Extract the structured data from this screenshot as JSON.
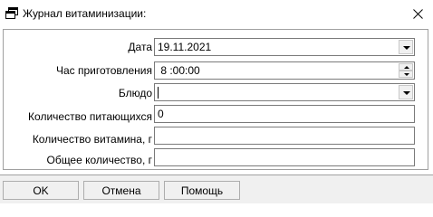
{
  "window": {
    "title": "Журнал витаминизации:",
    "icon": "window-app-icon",
    "close_icon": "close-icon"
  },
  "form": {
    "date": {
      "label": "Дата",
      "value": "19.11.2021",
      "control": "dropdown"
    },
    "prep_time": {
      "label": "Час приготовления",
      "value": " 8 :00:00",
      "control": "spin"
    },
    "dish": {
      "label": "Блюдо",
      "value": "",
      "control": "dropdown"
    },
    "eaters_count": {
      "label": "Количество питающихся",
      "value": "0"
    },
    "vitamin_amount": {
      "label": "Количество витамина, г",
      "value": ""
    },
    "total_amount": {
      "label": "Общее количество, г",
      "value": ""
    }
  },
  "buttons": {
    "ok": "OK",
    "cancel": "Отмена",
    "help": "Помощь"
  }
}
